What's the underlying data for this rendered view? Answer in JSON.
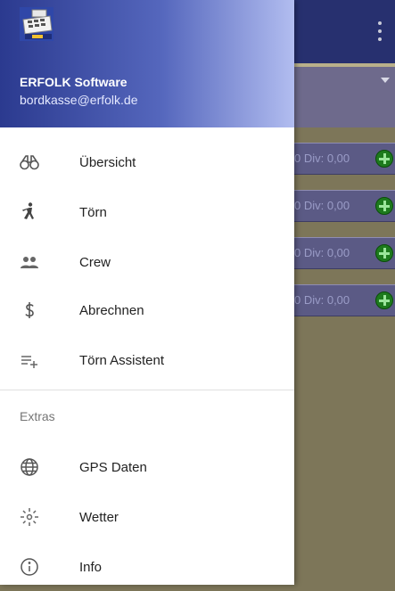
{
  "app": {
    "row_texts": [
      "0 Div: 0,00",
      "0 Div: 0,00",
      "0 Div: 0,00",
      "0 Div: 0,00"
    ]
  },
  "drawer": {
    "header": {
      "account_name": "ERFOLK Software",
      "account_email": "bordkasse@erfolk.de",
      "logo_icon": "cash-register-icon"
    },
    "menu_items": [
      {
        "label": "Übersicht",
        "icon": "binoculars-icon"
      },
      {
        "label": "Törn",
        "icon": "sailing-figure-icon"
      },
      {
        "label": "Crew",
        "icon": "people-icon"
      },
      {
        "label": "Abrechnen",
        "icon": "dollar-icon"
      },
      {
        "label": "Törn Assistent",
        "icon": "playlist-add-icon"
      }
    ],
    "extras_label": "Extras",
    "extras_items": [
      {
        "label": "GPS Daten",
        "icon": "globe-icon"
      },
      {
        "label": "Wetter",
        "icon": "sun-icon"
      },
      {
        "label": "Info",
        "icon": "info-icon"
      }
    ]
  },
  "colors": {
    "app_bar": "#27306f",
    "header_start": "#2b3a8f",
    "header_end": "#b2bdf0",
    "add_button": "#1d7a1d"
  }
}
